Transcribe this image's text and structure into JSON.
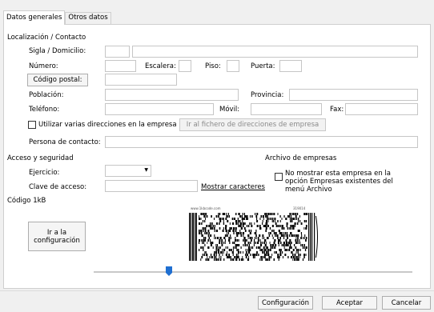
{
  "tabs": [
    "Datos generales",
    "Otros datos"
  ],
  "sections": {
    "localizacion": "Localización / Contacto",
    "acceso": "Acceso y seguridad",
    "archivo": "Archivo de empresas",
    "codigo": "Código 1kB"
  },
  "labels": {
    "sigla": "Sigla / Domicilio:",
    "numero": "Número:",
    "escalera": "Escalera:",
    "piso": "Piso:",
    "puerta": "Puerta:",
    "poblacion": "Población:",
    "provincia": "Provincia:",
    "telefono": "Teléfono:",
    "movil": "Móvil:",
    "fax": "Fax:",
    "varias_dir": "Utilizar varias direcciones en la empresa",
    "persona": "Persona de contacto:",
    "ejercicio": "Ejercicio:",
    "clave": "Clave de acceso:",
    "no_mostrar": "No mostrar esta empresa en la opción Empresas existentes del menú Archivo"
  },
  "buttons": {
    "codigo_postal": "Código postal:",
    "fichero_dir": "Ir al fichero de direcciones de empresa",
    "mostrar": "Mostrar caracteres",
    "ir_config": "Ir a la configuración",
    "configuracion": "Configuración",
    "aceptar": "Aceptar",
    "cancelar": "Cancelar"
  },
  "barcode": {
    "header_left": "www.1kbcode.com",
    "header_right": "319014"
  },
  "slider": {
    "value_fraction": 0.23
  },
  "colors": {
    "thumb": "#1f6fd1"
  }
}
